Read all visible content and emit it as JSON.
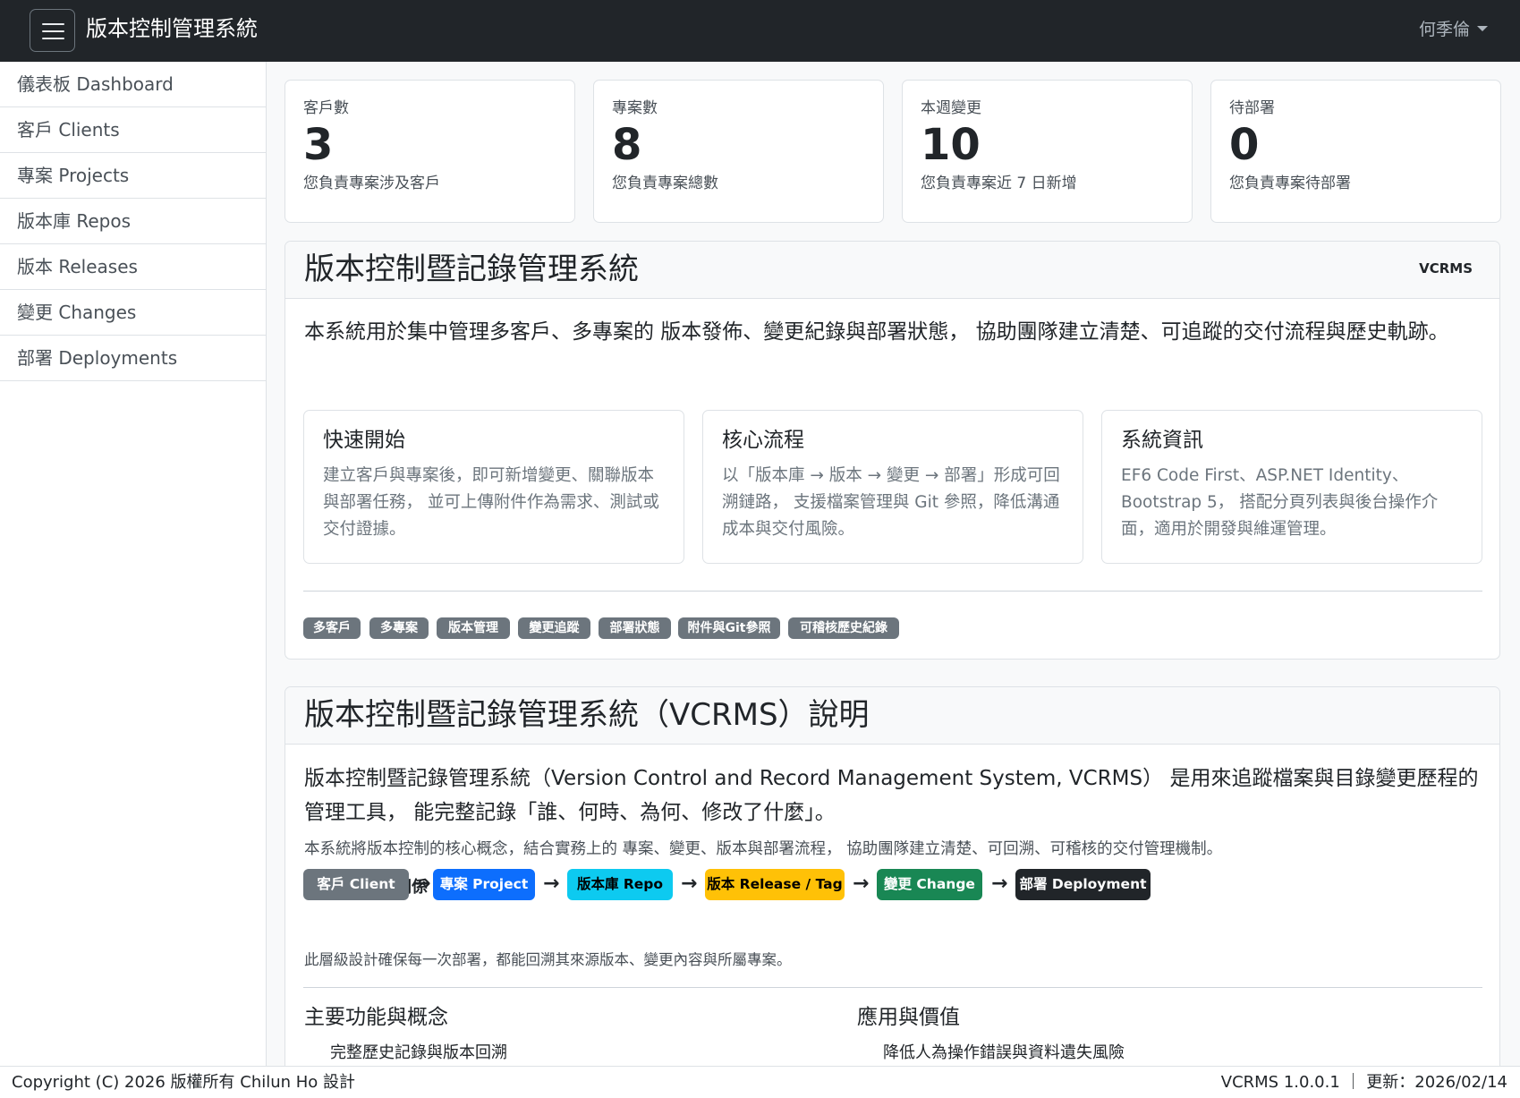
{
  "header": {
    "title": "版本控制管理系統",
    "user": "何季倫",
    "menu_toggle_icon": "hamburger-icon"
  },
  "sidebar": {
    "items": [
      {
        "label": "儀表板 Dashboard"
      },
      {
        "label": "客戶 Clients"
      },
      {
        "label": "專案 Projects"
      },
      {
        "label": "版本庫 Repos"
      },
      {
        "label": "版本 Releases"
      },
      {
        "label": "變更 Changes"
      },
      {
        "label": "部署 Deployments"
      }
    ]
  },
  "stats": [
    {
      "label": "客戶數",
      "value": "3",
      "desc": "您負責專案涉及客戶"
    },
    {
      "label": "專案數",
      "value": "8",
      "desc": "您負責專案總數"
    },
    {
      "label": "本週變更",
      "value": "10",
      "desc": "您負責專案近 7 日新增"
    },
    {
      "label": "待部署",
      "value": "0",
      "desc": "您負責專案待部署"
    }
  ],
  "intro": {
    "title": "版本控制暨記錄管理系統",
    "badge": "VCRMS",
    "lead": "本系統用於集中管理多客戶、多專案的 版本發佈、變更紀錄與部署狀態， 協助團隊建立清楚、可追蹤的交付流程與歷史軌跡。",
    "features": [
      {
        "title": "快速開始",
        "text": "建立客戶與專案後，即可新增變更、關聯版本與部署任務， 並可上傳附件作為需求、測試或交付證據。"
      },
      {
        "title": "核心流程",
        "text": "以「版本庫 → 版本 → 變更 → 部署」形成可回溯鏈路， 支援檔案管理與 Git 參照，降低溝通成本與交付風險。"
      },
      {
        "title": "系統資訊",
        "text": "EF6 Code First、ASP.NET Identity、Bootstrap 5， 搭配分頁列表與後台操作介面，適用於開發與維運管理。"
      }
    ],
    "tags": [
      "多客戶",
      "多專案",
      "版本管理",
      "變更追蹤",
      "部署狀態",
      "附件與Git參照",
      "可稽核歷史紀錄"
    ]
  },
  "about": {
    "title": "版本控制暨記錄管理系統（VCRMS）說明",
    "lead": "版本控制暨記錄管理系統（Version Control and Record Management System, VCRMS） 是用來追蹤檔案與目錄變更歷程的管理工具， 能完整記錄「誰、何時、為何、修改了什麼」。",
    "desc": "本系統將版本控制的核心概念，結合實務上的 專案、變更、版本與部署流程， 協助團隊建立清楚、可回溯、可稽核的交付管理機制。",
    "hierarchy_icon": "triangle-ruler-icon",
    "hierarchy_title": "系統層級關係",
    "flow": [
      {
        "label": "客戶 Client",
        "color": "#6c757d",
        "text_color": "#ffffff"
      },
      {
        "label": "專案 Project",
        "color": "#0d6efd",
        "text_color": "#ffffff"
      },
      {
        "label": "版本庫 Repo",
        "color": "#0dcaf0",
        "text_color": "#000000"
      },
      {
        "label": "版本 Release / Tag",
        "color": "#ffc107",
        "text_color": "#000000"
      },
      {
        "label": "變更 Change",
        "color": "#198754",
        "text_color": "#ffffff"
      },
      {
        "label": "部署 Deployment",
        "color": "#212529",
        "text_color": "#ffffff"
      }
    ],
    "arrow": "→",
    "note": "此層級設計確保每一次部署，都能回溯其來源版本、變更內容與所屬專案。",
    "col_left_title": "主要功能與概念",
    "col_right_title": "應用與價值",
    "col_left_first": "完整歷史記錄與版本回溯",
    "col_right_first": "降低人為操作錯誤與資料遺失風險"
  },
  "footer": {
    "copyright": "Copyright (C) 2026 版權所有 Chilun Ho 設計",
    "version": "VCRMS 1.0.0.1 ｜ 更新：2026/02/14"
  }
}
